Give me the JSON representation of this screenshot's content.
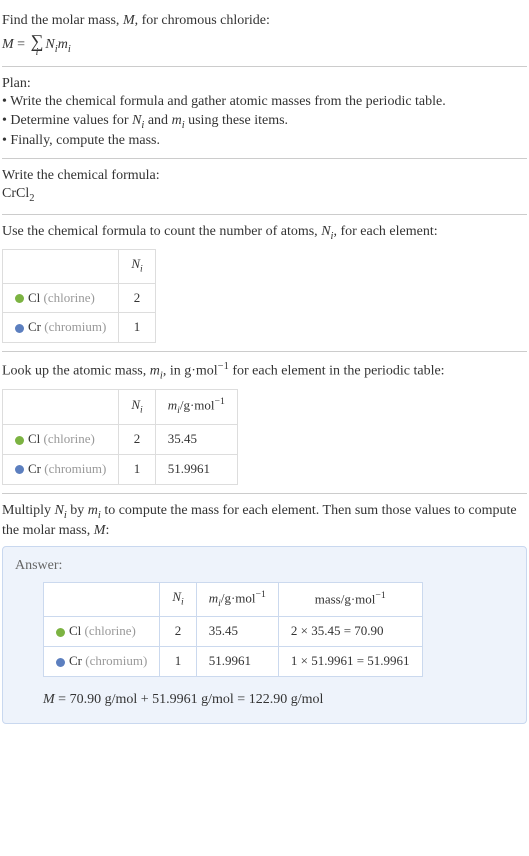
{
  "intro": {
    "line1_pre": "Find the molar mass, ",
    "line1_m": "M",
    "line1_post": ", for chromous chloride:",
    "formula_lhs": "M",
    "formula_eq": " = ",
    "formula_sigma": "∑",
    "formula_sigma_sub": "i",
    "formula_rhs1": "N",
    "formula_rhs1_sub": "i",
    "formula_rhs2": "m",
    "formula_rhs2_sub": "i"
  },
  "plan": {
    "heading": "Plan:",
    "b1": "• Write the chemical formula and gather atomic masses from the periodic table.",
    "b2_pre": "• Determine values for ",
    "b2_n": "N",
    "b2_nsub": "i",
    "b2_mid": " and ",
    "b2_m": "m",
    "b2_msub": "i",
    "b2_post": " using these items.",
    "b3": "• Finally, compute the mass."
  },
  "chem": {
    "heading": "Write the chemical formula:",
    "formula_base": "CrCl",
    "formula_sub": "2"
  },
  "count": {
    "heading_pre": "Use the chemical formula to count the number of atoms, ",
    "heading_n": "N",
    "heading_nsub": "i",
    "heading_post": ", for each element:",
    "col_n": "N",
    "col_n_sub": "i",
    "row1_el": "Cl",
    "row1_name": " (chlorine)",
    "row1_n": "2",
    "row2_el": "Cr",
    "row2_name": " (chromium)",
    "row2_n": "1"
  },
  "mass": {
    "heading_pre": "Look up the atomic mass, ",
    "heading_m": "m",
    "heading_msub": "i",
    "heading_mid": ", in g·mol",
    "heading_exp": "−1",
    "heading_post": " for each element in the periodic table:",
    "col_n": "N",
    "col_n_sub": "i",
    "col_m": "m",
    "col_m_sub": "i",
    "col_m_unit": "/g·mol",
    "col_m_exp": "−1",
    "row1_el": "Cl",
    "row1_name": " (chlorine)",
    "row1_n": "2",
    "row1_m": "35.45",
    "row2_el": "Cr",
    "row2_name": " (chromium)",
    "row2_n": "1",
    "row2_m": "51.9961"
  },
  "mult": {
    "pre": "Multiply ",
    "n": "N",
    "nsub": "i",
    "mid1": " by ",
    "m": "m",
    "msub": "i",
    "post": " to compute the mass for each element. Then sum those values to compute the molar mass, ",
    "mm": "M",
    "end": ":"
  },
  "answer": {
    "label": "Answer:",
    "col_n": "N",
    "col_n_sub": "i",
    "col_m": "m",
    "col_m_sub": "i",
    "col_m_unit": "/g·mol",
    "col_m_exp": "−1",
    "col_mass": "mass/g·mol",
    "col_mass_exp": "−1",
    "row1_el": "Cl",
    "row1_name": " (chlorine)",
    "row1_n": "2",
    "row1_m": "35.45",
    "row1_mass": "2 × 35.45 = 70.90",
    "row2_el": "Cr",
    "row2_name": " (chromium)",
    "row2_n": "1",
    "row2_m": "51.9961",
    "row2_mass": "1 × 51.9961 = 51.9961",
    "final_lhs": "M",
    "final_rhs": " = 70.90 g/mol + 51.9961 g/mol = 122.90 g/mol"
  }
}
